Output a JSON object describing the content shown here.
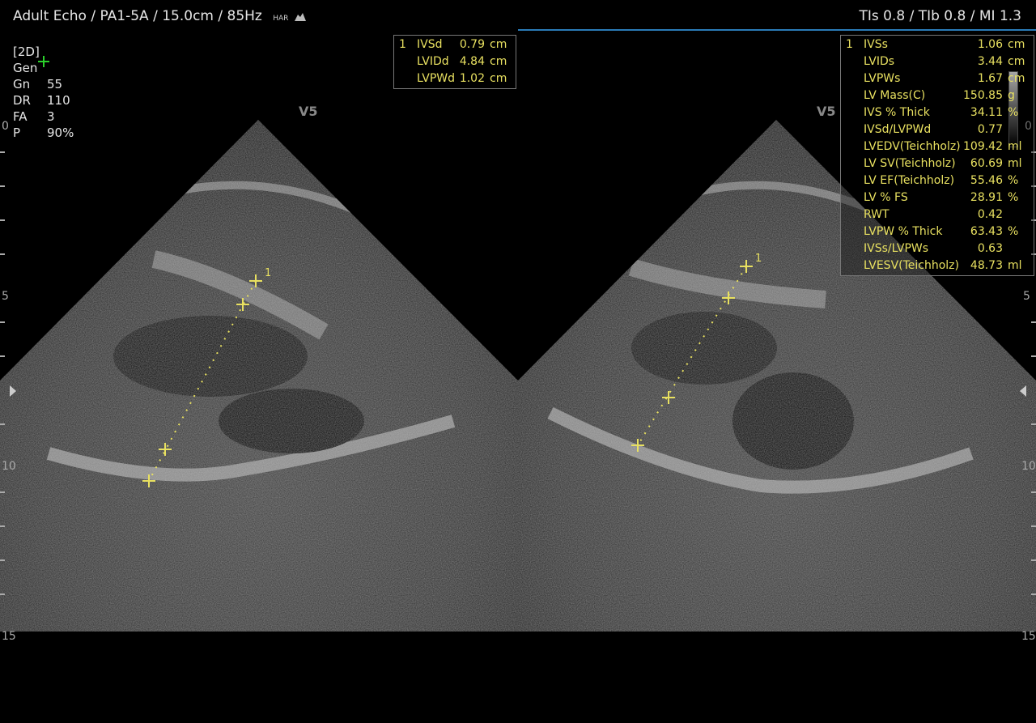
{
  "header": {
    "left": "Adult Echo / PA1-5A / 15.0cm / 85Hz",
    "har": "HAR",
    "right": "TIs  0.8 / TIb  0.8 / MI    1.3"
  },
  "params": {
    "mode": "[2D]",
    "gen": "Gen",
    "rows": [
      {
        "k": "Gn",
        "v": "55"
      },
      {
        "k": "DR",
        "v": "110"
      },
      {
        "k": "FA",
        "v": "3"
      },
      {
        "k": "P",
        "v": "90%"
      }
    ]
  },
  "probe_label": "V5",
  "scale": {
    "ticks": [
      "0",
      "5",
      "10",
      "15"
    ]
  },
  "left_meas": {
    "num": "1",
    "rows": [
      {
        "name": "IVSd",
        "value": "0.79",
        "unit": "cm"
      },
      {
        "name": "LVIDd",
        "value": "4.84",
        "unit": "cm"
      },
      {
        "name": "LVPWd",
        "value": "1.02",
        "unit": "cm"
      }
    ]
  },
  "right_meas": {
    "num": "1",
    "rows": [
      {
        "name": "IVSs",
        "value": "1.06",
        "unit": "cm"
      },
      {
        "name": "LVIDs",
        "value": "3.44",
        "unit": "cm"
      },
      {
        "name": "LVPWs",
        "value": "1.67",
        "unit": "cm"
      },
      {
        "name": "LV Mass(C)",
        "value": "150.85",
        "unit": "g"
      },
      {
        "name": "IVS % Thick",
        "value": "34.11",
        "unit": "%"
      },
      {
        "name": "IVSd/LVPWd",
        "value": "0.77",
        "unit": ""
      },
      {
        "name": "LVEDV(Teichholz)",
        "value": "109.42",
        "unit": "ml"
      },
      {
        "name": "LV SV(Teichholz)",
        "value": "60.69",
        "unit": "ml"
      },
      {
        "name": "LV EF(Teichholz)",
        "value": "55.46",
        "unit": "%"
      },
      {
        "name": "LV % FS",
        "value": "28.91",
        "unit": "%"
      },
      {
        "name": "RWT",
        "value": "0.42",
        "unit": ""
      },
      {
        "name": "LVPW % Thick",
        "value": "63.43",
        "unit": "%"
      },
      {
        "name": "IVSs/LVPWs",
        "value": "0.63",
        "unit": ""
      },
      {
        "name": "LVESV(Teichholz)",
        "value": "48.73",
        "unit": "ml"
      }
    ]
  },
  "caliper_label": "1"
}
